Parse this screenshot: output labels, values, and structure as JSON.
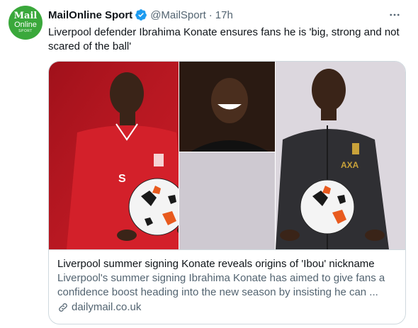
{
  "account": {
    "avatar_lines": [
      "Mail",
      "Online",
      "SPORT"
    ],
    "display_name": "MailOnline Sport",
    "handle": "@MailSport",
    "separator": "·",
    "time": "17h"
  },
  "tweet": {
    "text": "Liverpool defender Ibrahima Konate ensures fans he is 'big, strong and not scared of the ball'"
  },
  "card": {
    "title": "Liverpool summer signing Konate reveals origins of 'Ibou' nickname",
    "description": "Liverpool's summer signing Ibrahima Konate has aimed to give fans a confidence boost heading into the new season by insisting he can ...",
    "domain": "dailymail.co.uk"
  },
  "icons": {
    "verified": "verified-badge-icon",
    "more": "more-options-icon",
    "link": "link-icon"
  },
  "colors": {
    "brand_green": "#3aa83b",
    "verified_blue": "#1d9bf0",
    "secondary_text": "#536471",
    "liverpool_red": "#c8102e"
  }
}
